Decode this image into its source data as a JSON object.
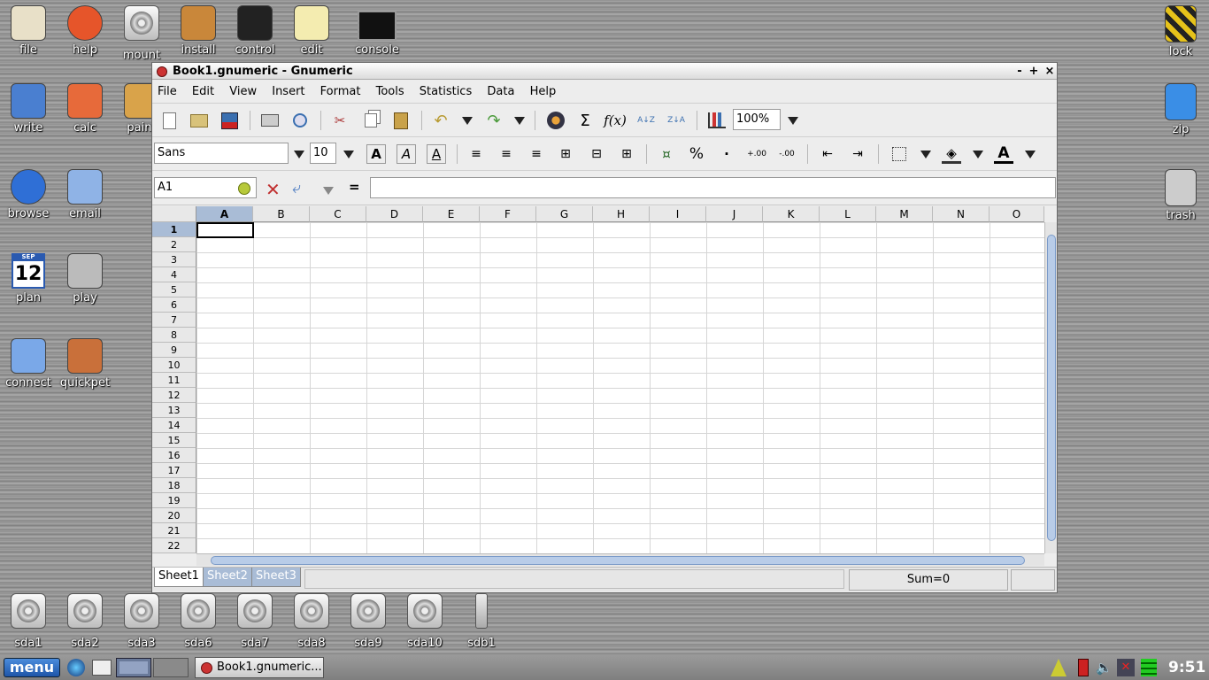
{
  "desktop_left": [
    {
      "label": "file",
      "icon": "house-icon"
    },
    {
      "label": "help",
      "icon": "lifebuoy-icon"
    },
    {
      "label": "mount",
      "icon": "hard-drive-icon"
    },
    {
      "label": "install",
      "icon": "package-icon"
    },
    {
      "label": "control",
      "icon": "top-hat-icon"
    },
    {
      "label": "edit",
      "icon": "notepad-icon"
    },
    {
      "label": "console",
      "icon": "terminal-icon"
    },
    {
      "label": "write",
      "icon": "pencil-doc-icon"
    },
    {
      "label": "calc",
      "icon": "calculator-doc-icon"
    },
    {
      "label": "paint",
      "icon": "palette-icon"
    },
    {
      "label": "browse",
      "icon": "globe-icon"
    },
    {
      "label": "email",
      "icon": "envelope-icon"
    },
    {
      "label": "plan",
      "icon": "calendar-icon"
    },
    {
      "label": "play",
      "icon": "speaker-icon"
    },
    {
      "label": "connect",
      "icon": "network-icon"
    },
    {
      "label": "quickpet",
      "icon": "pet-box-icon"
    }
  ],
  "calendar_day": "12",
  "calendar_month": "SEP",
  "desktop_right": [
    {
      "label": "lock",
      "icon": "padlock-icon"
    },
    {
      "label": "zip",
      "icon": "archive-icon"
    },
    {
      "label": "trash",
      "icon": "trash-icon"
    }
  ],
  "drives": [
    "sda1",
    "sda2",
    "sda3",
    "sda6",
    "sda7",
    "sda8",
    "sda9",
    "sda10",
    "sdb1"
  ],
  "window": {
    "title": "Book1.gnumeric - Gnumeric",
    "min": "-",
    "max": "+",
    "close": "×"
  },
  "menu": [
    "File",
    "Edit",
    "View",
    "Insert",
    "Format",
    "Tools",
    "Statistics",
    "Data",
    "Help"
  ],
  "toolbar": {
    "zoom": "100%",
    "font": "Sans",
    "size": "10"
  },
  "formula": {
    "cell_ref": "A1",
    "equals": "=",
    "value": ""
  },
  "columns": [
    "A",
    "B",
    "C",
    "D",
    "E",
    "F",
    "G",
    "H",
    "I",
    "J",
    "K",
    "L",
    "M",
    "N",
    "O"
  ],
  "rows": [
    "1",
    "2",
    "3",
    "4",
    "5",
    "6",
    "7",
    "8",
    "9",
    "10",
    "11",
    "12",
    "13",
    "14",
    "15",
    "16",
    "17",
    "18",
    "19",
    "20",
    "21",
    "22"
  ],
  "sheets": [
    "Sheet1",
    "Sheet2",
    "Sheet3"
  ],
  "status": {
    "sum": "Sum=0"
  },
  "taskbar": {
    "menu": "menu",
    "task": "Book1.gnumeric...",
    "clock": "9:51"
  }
}
